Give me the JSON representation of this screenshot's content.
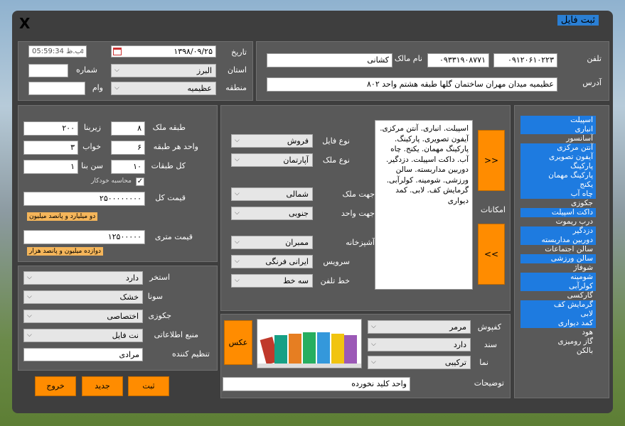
{
  "title": "ثبت فایل",
  "close_label": "X",
  "top": {
    "tel_label": "تلفن",
    "tel1": "۰۹۱۲۰۶۱۰۲۲۳",
    "tel2": "۰۹۳۳۱۹۰۸۷۷۱",
    "owner_label": "نام مالک",
    "owner": "کشانی",
    "address_label": "آدرس",
    "address": "عظیمیه میدان مهران ساختمان گلها طبقه هشتم واحد ۸۰۲",
    "date_label": "تاریخ",
    "date": "۱۳۹۸/۰۹/۲۵",
    "time": "05:59:34 ب.ظ",
    "province_label": "استان",
    "province": "البرز",
    "region_label": "منطقه",
    "region": "عظیمیه",
    "number_label": "شماره",
    "number": "",
    "loan_label": "وام",
    "loan": ""
  },
  "specs": {
    "floor_label": "طبقه ملک",
    "floor": "۸",
    "area_label": "زیربنا",
    "area": "۲۰۰",
    "units_label": "واحد هر طبقه",
    "units": "۶",
    "rooms_label": "خواب",
    "rooms": "۳",
    "floors_label": "کل طبقات",
    "floors": "۱۰",
    "age_label": "سن بنا",
    "age": "۱",
    "auto_calc_label": "محاسبه خودکار",
    "price_label": "قیمت کل",
    "price": "۲۵۰۰۰۰۰۰۰۰",
    "price_words": "دو میلیارد و پانصد میلیون",
    "meter_label": "قیمت متری",
    "meter_price": "۱۲۵۰۰۰۰۰",
    "meter_words": "دوازده میلیون و پانصد هزار"
  },
  "extras": {
    "pool_label": "استخر",
    "pool": "دارد",
    "sauna_label": "سونا",
    "sauna": "خشک",
    "jacuzzi_label": "جکوزی",
    "jacuzzi": "اختصاصی",
    "source_label": "منبع اطلاعاتی",
    "source": "نت فایل",
    "author_label": "تنظیم کننده",
    "author": "مرادی"
  },
  "buttons": {
    "submit": "ثبت",
    "new": "جدید",
    "exit": "خروج",
    "add": ">>",
    "remove": "<<",
    "photo": "عکس"
  },
  "type": {
    "file_type_label": "نوع فایل",
    "file_type": "فروش",
    "prop_type_label": "نوع ملک",
    "prop_type": "آپارتمان",
    "prop_dir_label": "جهت ملک",
    "prop_dir": "شمالی",
    "unit_dir_label": "جهت واحد",
    "unit_dir": "جنوبی",
    "kitchen_label": "آشپزخانه",
    "kitchen": "ممبران",
    "wc_label": "سرویس",
    "wc": "ایرانی فرنگی",
    "phone_line_label": "خط تلفن",
    "phone_line": "سه خط"
  },
  "amenities_label": "امکانات",
  "amenities_text": "اسپیلت. انباری. آنتن مرکزی. آیفون تصویری. پارکینگ. پارکینگ مهمان. یکنج. چاه آب. داکت اسپیلت. دزدگیر. دوربین مداربسته. سالن ورزشی. شومینه. کولرآبی. گرمایش کف. لابی. کمد دیواری",
  "amenity_list": [
    {
      "label": "اسپیلت",
      "selected": true
    },
    {
      "label": "انباری",
      "selected": true
    },
    {
      "label": "آسانسور",
      "selected": false
    },
    {
      "label": "آنتن مرکزی",
      "selected": true
    },
    {
      "label": "آیفون تصویری",
      "selected": true
    },
    {
      "label": "پارکینگ",
      "selected": true
    },
    {
      "label": "پارکینگ مهمان",
      "selected": true
    },
    {
      "label": "یکنج",
      "selected": true
    },
    {
      "label": "چاه آب",
      "selected": true
    },
    {
      "label": "جکوزی",
      "selected": false
    },
    {
      "label": "داکت اسپیلت",
      "selected": true
    },
    {
      "label": "درب ریموت",
      "selected": false
    },
    {
      "label": "دزدگیر",
      "selected": true
    },
    {
      "label": "دوربین مداربسته",
      "selected": true
    },
    {
      "label": "سالن اجتماعات",
      "selected": false
    },
    {
      "label": "سالن ورزشی",
      "selected": true
    },
    {
      "label": "شوفاژ",
      "selected": false
    },
    {
      "label": "شومینه",
      "selected": true
    },
    {
      "label": "کولرآبی",
      "selected": true
    },
    {
      "label": "گارکسی",
      "selected": false
    },
    {
      "label": "گرمایش کف",
      "selected": true
    },
    {
      "label": "لابی",
      "selected": true
    },
    {
      "label": "کمد دیواری",
      "selected": true
    },
    {
      "label": "هود",
      "selected": false
    },
    {
      "label": "گاز رومیزی",
      "selected": false
    },
    {
      "label": "بالکن",
      "selected": false
    }
  ],
  "finish": {
    "floor_label": "کفپوش",
    "floor": "مرمر",
    "deed_label": "سند",
    "deed": "دارد",
    "facade_label": "نما",
    "facade": "ترکیبی",
    "desc_label": "توضیحات",
    "desc": "واحد کلید نخورده"
  },
  "colors": {
    "accent": "#ff8c00",
    "selection": "#1e7be0",
    "title_bg": "#2a7fd4"
  }
}
